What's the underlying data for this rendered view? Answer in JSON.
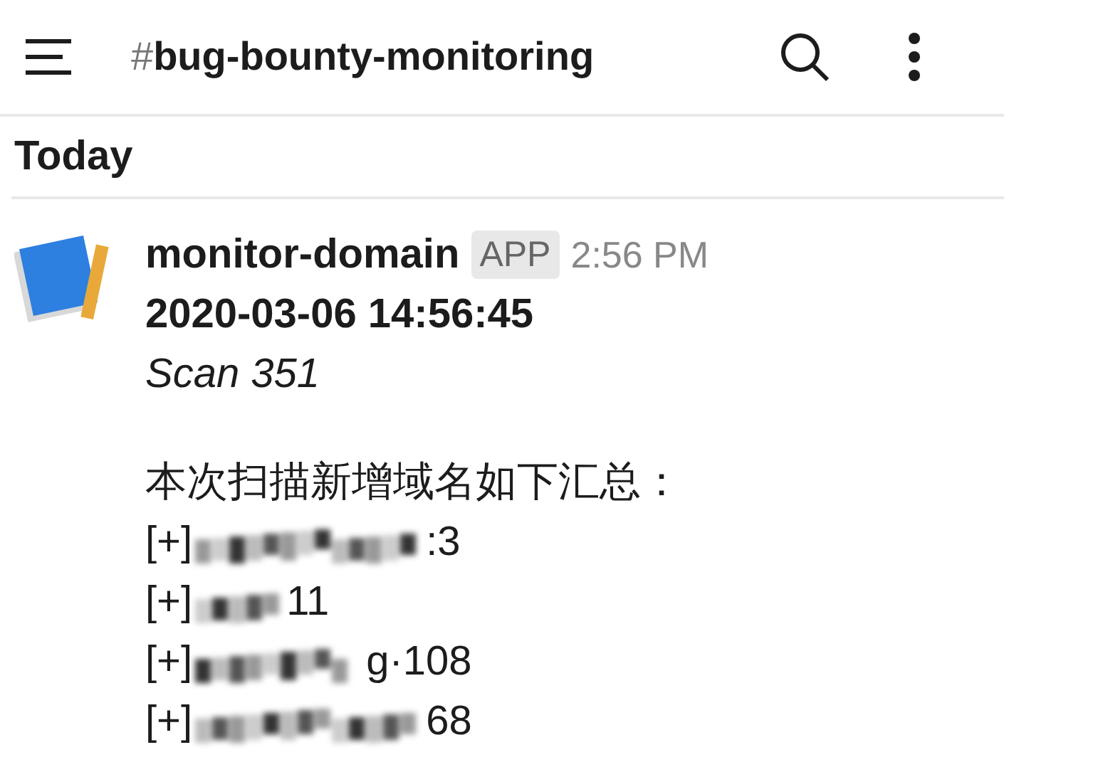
{
  "header": {
    "channel_prefix": "#",
    "channel": "bug-bounty-monitoring"
  },
  "day_divider": "Today",
  "message": {
    "sender": "monitor-domain",
    "badge": "APP",
    "time": "2:56 PM",
    "timestamp": "2020-03-06 14:56:45",
    "scan": "Scan 351",
    "summary": "本次扫描新增域名如下汇总：",
    "entries": [
      {
        "prefix": "[+]",
        "suffix": ":3",
        "redacted": true
      },
      {
        "prefix": "[+]",
        "suffix": "11",
        "redacted": true
      },
      {
        "prefix": "[+]",
        "suffix": "g·108",
        "redacted": true
      },
      {
        "prefix": "[+]",
        "suffix": "68",
        "redacted": true
      }
    ]
  }
}
